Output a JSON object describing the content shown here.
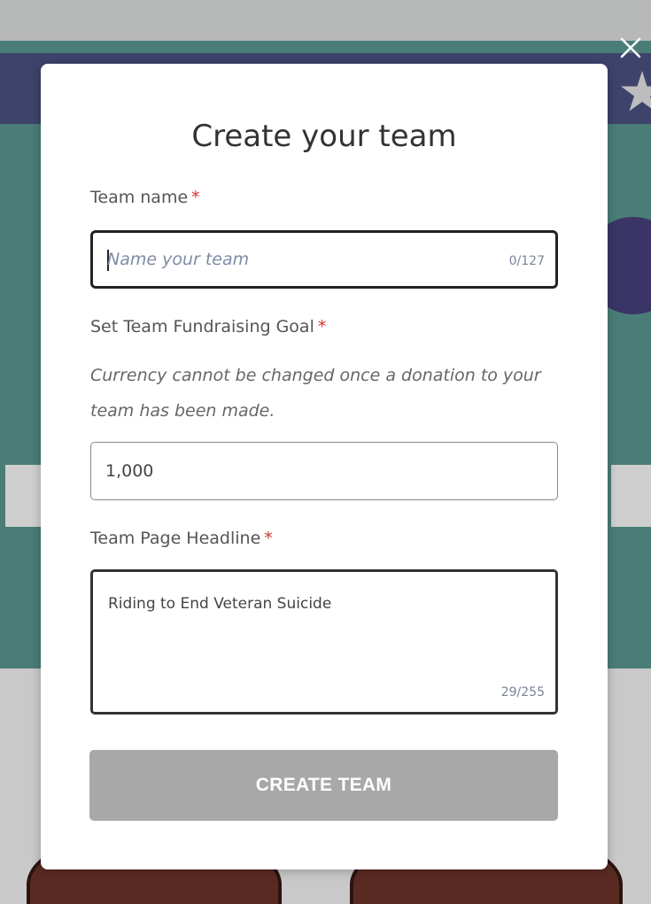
{
  "modal": {
    "title": "Create your team",
    "close_icon": "close-icon",
    "team_name": {
      "label": "Team name",
      "required_mark": "*",
      "placeholder": "Name your team",
      "value": "",
      "counter": "0/127"
    },
    "fundraising_goal": {
      "label": "Set Team Fundraising Goal",
      "required_mark": "*",
      "note": "Currency cannot be changed once a donation to your team has been made.",
      "value": "1,000"
    },
    "headline": {
      "label": "Team Page Headline",
      "required_mark": "*",
      "value": "Riding to End Veteran Suicide",
      "counter": "29/255"
    },
    "submit_label": "CREATE TEAM"
  },
  "colors": {
    "required": "#d0342c",
    "button_disabled": "#a8a8a8",
    "placeholder": "#7e8aa6",
    "background_teal": "#4a7d77"
  }
}
